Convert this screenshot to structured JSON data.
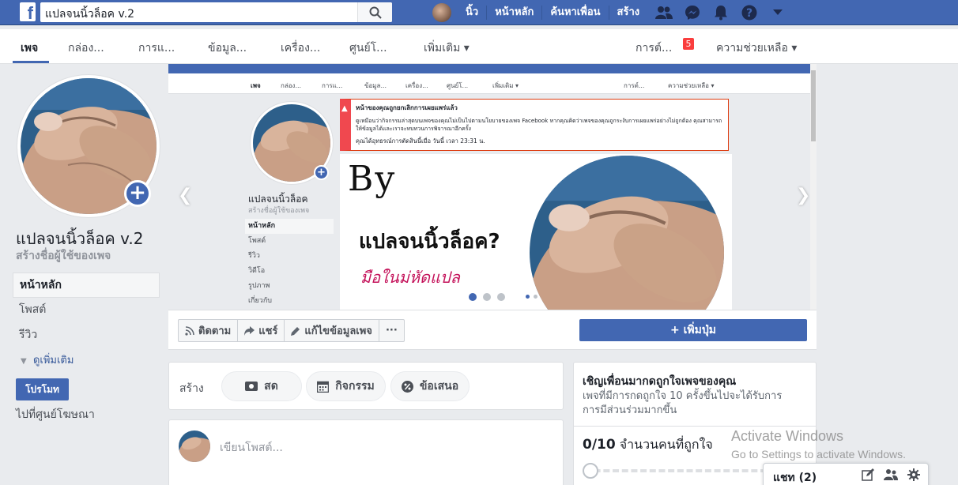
{
  "topbar": {
    "search_value": "แปลจนนิ้วล็อค v.2",
    "user_name": "นิ้ว",
    "home": "หน้าหลัก",
    "find_friends": "ค้นหาเพื่อน",
    "create": "สร้าง",
    "help_glyph": "?"
  },
  "page_tabs": {
    "page": "เพจ",
    "inbox": "กล่อง...",
    "manage": "การแ...",
    "insights": "ข้อมูล...",
    "tools": "เครื่อง...",
    "center": "ศูนย์โ...",
    "more": "เพิ่มเติม ▾",
    "notifications": "การต์...",
    "notif_count": "5",
    "help": "ความช่วยเหลือ ▾"
  },
  "left": {
    "page_name": "แปลจนนิ้วล็อค v.2",
    "username_prompt": "สร้างชื่อผู้ใช้ของเพจ",
    "nav": [
      "หน้าหลัก",
      "โพสต์",
      "รีวิว"
    ],
    "see_more": "ดูเพิ่มเติม",
    "promote": "โปรโมท",
    "ad_center": "ไปที่ศูนย์โฆษณา"
  },
  "cover": {
    "nav": [
      "เพจ",
      "กล่อง...",
      "การแ...",
      "ข้อมูล...",
      "เครื่อง...",
      "ศูนย์โ...",
      "เพิ่มเติม ▾",
      "การต์...",
      "ความช่วยเหลือ ▾"
    ],
    "shot_page_name": "แปลจนนิ้วล็อค",
    "shot_username": "สร้างชื่อผู้ใช้ของเพจ",
    "shot_left_nav": [
      "หน้าหลัก",
      "โพสต์",
      "รีวิว",
      "วิดีโอ",
      "รูปภาพ",
      "เกี่ยวกับ"
    ],
    "alert_title": "หน้าของคุณถูกยกเลิกการเผยแพร่แล้ว",
    "alert_body": "ดูเหมือนว่ากิจกรรมล่าสุดบนเพจของคุณไม่เป็นไปตามนโยบายของเพจ Facebook หากคุณคิดว่าเพจของคุณถูกระงับการเผยแพร่อย่างไม่ถูกต้อง คุณสามารถให้ข้อมูลได้และเราจะทบทวนการพิจารณาอีกครั้ง",
    "alert_time": "คุณได้อุทธรณ์การตัดสินนี้เมื่อ วันนี้ เวลา 23:31 น.",
    "by_text": "By",
    "title_text": "แปลจนนิ้วล็อค?",
    "sub_text": "มือในม่หัดแปล"
  },
  "actions": {
    "follow": "ติดตาม",
    "share": "แชร์",
    "edit": "แก้ไขข้อมูลเพจ",
    "more": "···",
    "add_button": "+ เพิ่มปุ่ม"
  },
  "create": {
    "label": "สร้าง",
    "live": "สด",
    "event": "กิจกรรม",
    "offer": "ข้อเสนอ"
  },
  "post": {
    "placeholder": "เขียนโพสต์..."
  },
  "invite": {
    "title": "เชิญเพื่อนมากดถูกใจเพจของคุณ",
    "desc": "เพจที่มีการกดถูกใจ 10 ครั้งขึ้นไปจะได้รับการการมีส่วนร่วมมากขึ้น",
    "count": "0/10",
    "count_label": "จำนวนคนที่ถูกใจ",
    "progress": 0
  },
  "watermark": {
    "line1": "Activate Windows",
    "line2": "Go to Settings to activate Windows."
  },
  "chat": {
    "label": "แชท (2)"
  },
  "colors": {
    "brand": "#4267b2",
    "badge": "#fa3e3e",
    "alert": "#f0484f"
  }
}
